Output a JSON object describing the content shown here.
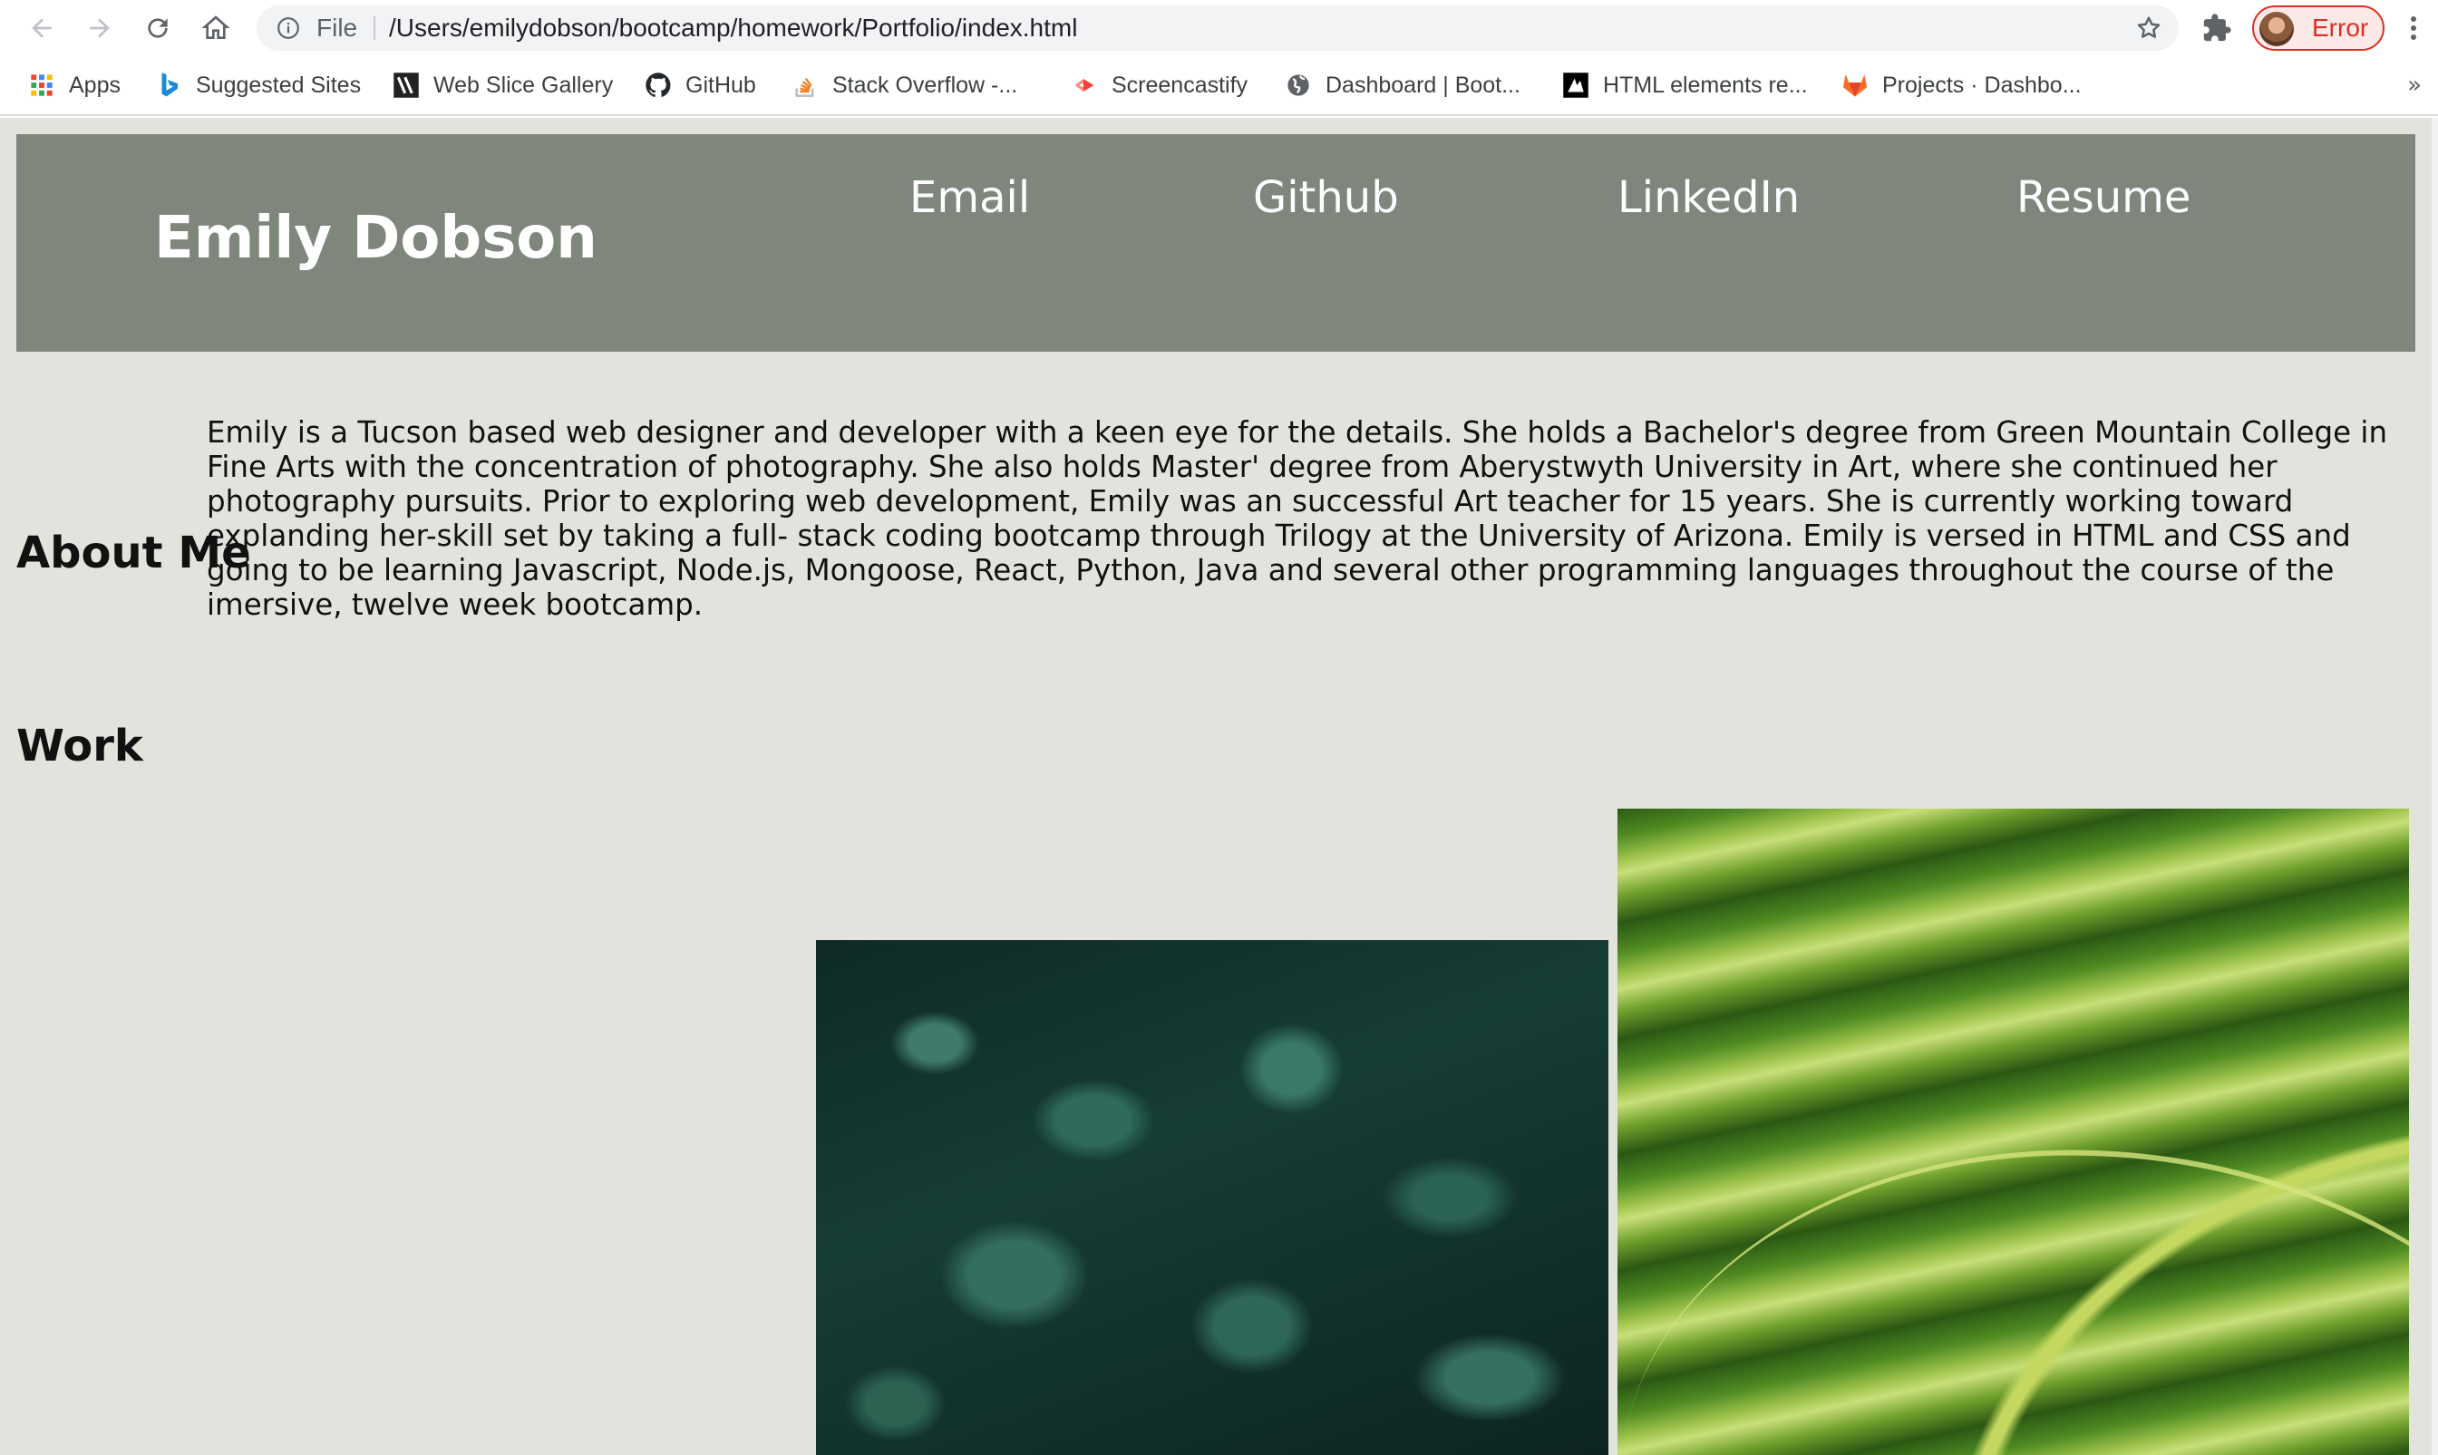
{
  "browser": {
    "scheme": "File",
    "url": "/Users/emilydobson/bootcamp/homework/Portfolio/index.html",
    "profile_status": "Error",
    "bookmarks": [
      {
        "label": "Apps",
        "icon": "apps-grid-icon"
      },
      {
        "label": "Suggested Sites",
        "icon": "bing-icon"
      },
      {
        "label": "Web Slice Gallery",
        "icon": "web-slice-icon"
      },
      {
        "label": "GitHub",
        "icon": "github-icon"
      },
      {
        "label": "Stack Overflow -...",
        "icon": "stackoverflow-icon"
      },
      {
        "label": "Screencastify",
        "icon": "screencastify-icon"
      },
      {
        "label": "Dashboard | Boot...",
        "icon": "globe-icon"
      },
      {
        "label": "HTML elements re...",
        "icon": "mdn-icon"
      },
      {
        "label": "Projects · Dashbo...",
        "icon": "gitlab-icon"
      }
    ],
    "more_bookmarks": "»"
  },
  "page": {
    "hero": {
      "name": "Emily Dobson",
      "nav": [
        "Email",
        "Github",
        "LinkedIn",
        "Resume"
      ]
    },
    "about": {
      "title": "About Me",
      "text": "Emily is a Tucson based web designer and developer with a keen eye for the details. She holds a Bachelor's degree from Green Mountain College in Fine Arts with the concentration of photography. She also holds Master' degree from Aberystwyth University in Art, where she continued her photography pursuits. Prior to exploring web development, Emily was an successful Art teacher for 15 years. She is currently working toward explanding her-skill set by taking a full- stack coding bootcamp through Trilogy at the University of Arizona. Emily is versed in HTML and CSS and going to be learning Javascript, Node.js, Mongoose, React, Python, Java and several other programming languages throughout the course of the imersive, twelve week bootcamp."
    },
    "work": {
      "title": "Work"
    }
  },
  "colors": {
    "hero_bg": "#7f877c",
    "page_bg": "#e3e3de",
    "profile_error": "#d93025"
  }
}
